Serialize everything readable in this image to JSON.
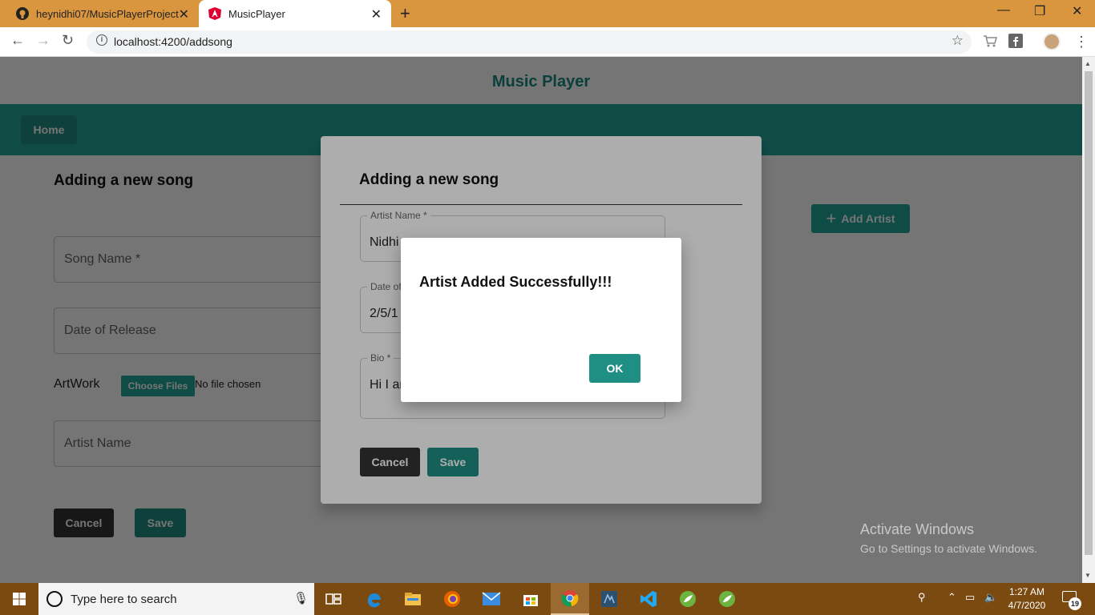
{
  "browser": {
    "tabs": [
      {
        "title": "heynidhi07/MusicPlayerProject",
        "icon": "github-icon"
      },
      {
        "title": "MusicPlayer",
        "icon": "angular-icon",
        "active": true
      }
    ],
    "url": "localhost:4200/addsong"
  },
  "app": {
    "title": "Music Player",
    "nav": {
      "home_label": "Home"
    }
  },
  "song_form": {
    "heading": "Adding a new song",
    "song_name_placeholder": "Song Name *",
    "date_placeholder": "Date of Release",
    "artwork_label": "ArtWork",
    "choose_files_label": "Choose Files",
    "no_file_text": "No file chosen",
    "artist_name_placeholder": "Artist Name",
    "cancel_label": "Cancel",
    "save_label": "Save",
    "add_artist_label": "Add Artist"
  },
  "artist_dialog": {
    "title": "Adding a new song",
    "artist_name_label": "Artist Name *",
    "artist_name_value": "Nidhi",
    "date_label": "Date of",
    "date_value": "2/5/1",
    "bio_label": "Bio *",
    "bio_value": "Hi I ar",
    "cancel_label": "Cancel",
    "save_label": "Save"
  },
  "alert": {
    "message": "Artist Added Successfully!!!",
    "ok_label": "OK"
  },
  "watermark": {
    "line1": "Activate Windows",
    "line2": "Go to Settings to activate Windows."
  },
  "taskbar": {
    "search_placeholder": "Type here to search",
    "time": "1:27 AM",
    "date": "4/7/2020",
    "notification_count": "19"
  },
  "colors": {
    "teal": "#26a69a",
    "dark_teal": "#1f8f84",
    "tab_strip": "#d9963f",
    "taskbar": "#7b4a10"
  }
}
